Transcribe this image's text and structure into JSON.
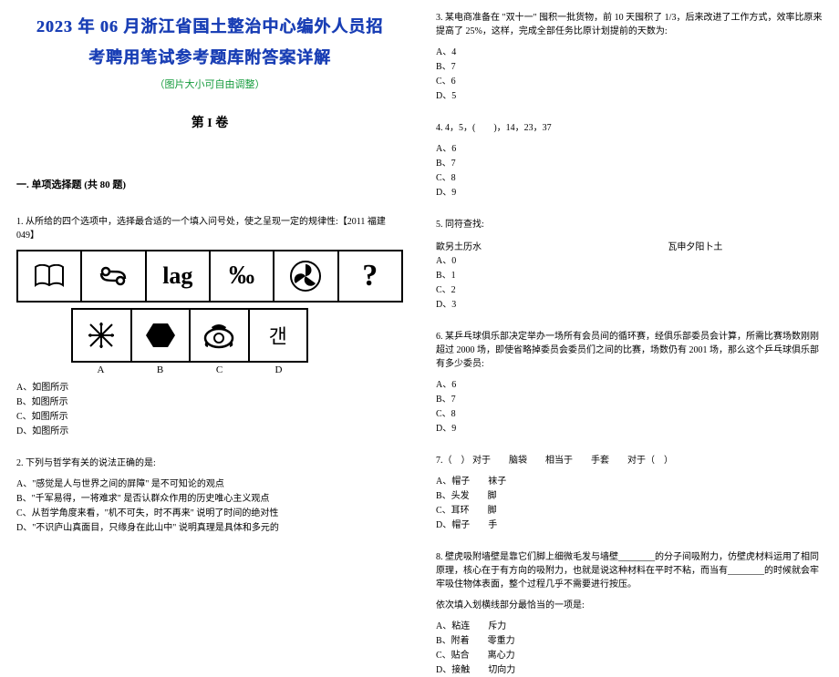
{
  "header": {
    "title_line1": "2023 年 06 月浙江省国土整治中心编外人员招",
    "title_line2": "考聘用笔试参考题库附答案详解",
    "subtitle": "（图片大小可自由调整）",
    "volume": "第 I 卷"
  },
  "section1": "一. 单项选择题 (共 80 题)",
  "q1": {
    "stem": "1. 从所给的四个选项中，选择最合适的一个填入问号处，使之呈现一定的规律性:【2011 福建 049】",
    "row_labels": [
      "A",
      "B",
      "C",
      "D"
    ],
    "opts": [
      "A、如图所示",
      "B、如图所示",
      "C、如图所示",
      "D、如图所示"
    ]
  },
  "q2": {
    "stem": "2. 下列与哲学有关的说法正确的是:",
    "opts": [
      "A、\"感觉是人与世界之间的屏障\" 是不可知论的观点",
      "B、\"千军易得，一将难求\" 是否认群众作用的历史唯心主义观点",
      "C、从哲学角度来看，\"机不可失，时不再来\" 说明了时间的绝对性",
      "D、\"不识庐山真面目，只缘身在此山中\" 说明真理是具体和多元的"
    ]
  },
  "q3": {
    "stem": "3. 某电商准备在 \"双十一\" 囤积一批货物，前 10 天囤积了 1/3，后来改进了工作方式，效率比原来提高了 25%，这样，完成全部任务比原计划提前的天数为:",
    "opts": [
      "A、4",
      "B、7",
      "C、6",
      "D、5"
    ]
  },
  "q4": {
    "stem": "4. 4，5，(　　)，14，23，37",
    "opts": [
      "A、6",
      "B、7",
      "C、8",
      "D、9"
    ]
  },
  "q5": {
    "stem": "5. 同符查找:",
    "left": "歐另土历水",
    "right": "瓦申夕阳卜土",
    "opts": [
      "A、0",
      "B、1",
      "C、2",
      "D、3"
    ]
  },
  "q6": {
    "stem": "6. 某乒乓球俱乐部决定举办一场所有会员间的循环赛，经俱乐部委员会计算，所需比赛场数刚刚超过 2000 场，即使省略掉委员会委员们之间的比赛，场数仍有 2001 场，那么这个乒乓球俱乐部有多少委员:",
    "opts": [
      "A、6",
      "B、7",
      "C、8",
      "D、9"
    ]
  },
  "q7": {
    "stem": "7.（　） 对于　　脑袋　　相当于　　手套　　对于（　）",
    "opts": [
      "A、帽子　　袜子",
      "B、头发　　脚",
      "C、耳环　　脚",
      "D、帽子　　手"
    ]
  },
  "q8": {
    "stem": "8. 壁虎吸附墙壁是靠它们脚上细微毛发与墙壁________的分子间吸附力，仿壁虎材料运用了相同原理，核心在于有方向的吸附力，也就是说这种材料在平时不粘，而当有________的时候就会牢牢吸住物体表面，整个过程几乎不需要进行按压。",
    "sub": "依次填入划横线部分最恰当的一项是:",
    "opts": [
      "A、粘连　　斥力",
      "B、附着　　零重力",
      "C、贴合　　离心力",
      "D、接触　　切向力"
    ]
  },
  "fig1": {
    "c3": "lag",
    "c4": "‰",
    "c6": "?"
  },
  "fig2": {
    "d": "갠"
  }
}
